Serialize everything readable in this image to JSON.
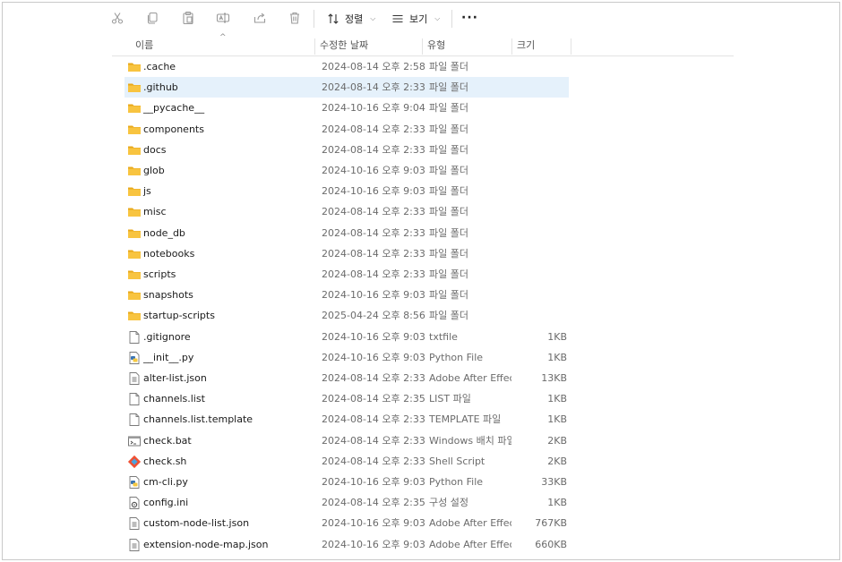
{
  "toolbar": {
    "sort_label": "정렬",
    "view_label": "보기",
    "more_label": "···"
  },
  "columns": {
    "name": "이름",
    "modified": "수정한 날짜",
    "type": "유형",
    "size": "크기"
  },
  "sort_indicator": "^",
  "files": [
    {
      "name": ".cache",
      "modified": "2024-08-14 오후 2:58",
      "type": "파일 폴더",
      "size": "",
      "icon": "folder-icon"
    },
    {
      "name": ".github",
      "modified": "2024-08-14 오후 2:33",
      "type": "파일 폴더",
      "size": "",
      "icon": "folder-icon"
    },
    {
      "name": "__pycache__",
      "modified": "2024-10-16 오후 9:04",
      "type": "파일 폴더",
      "size": "",
      "icon": "folder-icon"
    },
    {
      "name": "components",
      "modified": "2024-08-14 오후 2:33",
      "type": "파일 폴더",
      "size": "",
      "icon": "folder-icon"
    },
    {
      "name": "docs",
      "modified": "2024-08-14 오후 2:33",
      "type": "파일 폴더",
      "size": "",
      "icon": "folder-icon"
    },
    {
      "name": "glob",
      "modified": "2024-10-16 오후 9:03",
      "type": "파일 폴더",
      "size": "",
      "icon": "folder-icon"
    },
    {
      "name": "js",
      "modified": "2024-10-16 오후 9:03",
      "type": "파일 폴더",
      "size": "",
      "icon": "folder-icon"
    },
    {
      "name": "misc",
      "modified": "2024-08-14 오후 2:33",
      "type": "파일 폴더",
      "size": "",
      "icon": "folder-icon"
    },
    {
      "name": "node_db",
      "modified": "2024-08-14 오후 2:33",
      "type": "파일 폴더",
      "size": "",
      "icon": "folder-icon"
    },
    {
      "name": "notebooks",
      "modified": "2024-08-14 오후 2:33",
      "type": "파일 폴더",
      "size": "",
      "icon": "folder-icon"
    },
    {
      "name": "scripts",
      "modified": "2024-08-14 오후 2:33",
      "type": "파일 폴더",
      "size": "",
      "icon": "folder-icon"
    },
    {
      "name": "snapshots",
      "modified": "2024-10-16 오후 9:03",
      "type": "파일 폴더",
      "size": "",
      "icon": "folder-icon"
    },
    {
      "name": "startup-scripts",
      "modified": "2025-04-24 오후 8:56",
      "type": "파일 폴더",
      "size": "",
      "icon": "folder-icon"
    },
    {
      "name": ".gitignore",
      "modified": "2024-10-16 오후 9:03",
      "type": "txtfile",
      "size": "1KB",
      "icon": "blank-file-icon"
    },
    {
      "name": "__init__.py",
      "modified": "2024-10-16 오후 9:03",
      "type": "Python File",
      "size": "1KB",
      "icon": "python-file-icon"
    },
    {
      "name": "alter-list.json",
      "modified": "2024-08-14 오후 2:33",
      "type": "Adobe After Effec...",
      "size": "13KB",
      "icon": "text-file-icon"
    },
    {
      "name": "channels.list",
      "modified": "2024-08-14 오후 2:35",
      "type": "LIST 파일",
      "size": "1KB",
      "icon": "blank-file-icon"
    },
    {
      "name": "channels.list.template",
      "modified": "2024-08-14 오후 2:33",
      "type": "TEMPLATE 파일",
      "size": "1KB",
      "icon": "blank-file-icon"
    },
    {
      "name": "check.bat",
      "modified": "2024-08-14 오후 2:33",
      "type": "Windows 배치 파일",
      "size": "2KB",
      "icon": "batch-file-icon"
    },
    {
      "name": "check.sh",
      "modified": "2024-08-14 오후 2:33",
      "type": "Shell Script",
      "size": "2KB",
      "icon": "git-shell-icon"
    },
    {
      "name": "cm-cli.py",
      "modified": "2024-10-16 오후 9:03",
      "type": "Python File",
      "size": "33KB",
      "icon": "python-file-icon"
    },
    {
      "name": "config.ini",
      "modified": "2024-08-14 오후 2:35",
      "type": "구성 설정",
      "size": "1KB",
      "icon": "settings-file-icon"
    },
    {
      "name": "custom-node-list.json",
      "modified": "2024-10-16 오후 9:03",
      "type": "Adobe After Effec...",
      "size": "767KB",
      "icon": "text-file-icon"
    },
    {
      "name": "extension-node-map.json",
      "modified": "2024-10-16 오후 9:03",
      "type": "Adobe After Effec...",
      "size": "660KB",
      "icon": "text-file-icon"
    }
  ],
  "selected_index": 1,
  "colors": {
    "folder": "#f8c440",
    "folder_dark": "#e8a91b",
    "selection": "#e5f1fb",
    "python_blue": "#3a74b4",
    "python_yellow": "#f6c83f",
    "git_orange": "#f05033"
  }
}
